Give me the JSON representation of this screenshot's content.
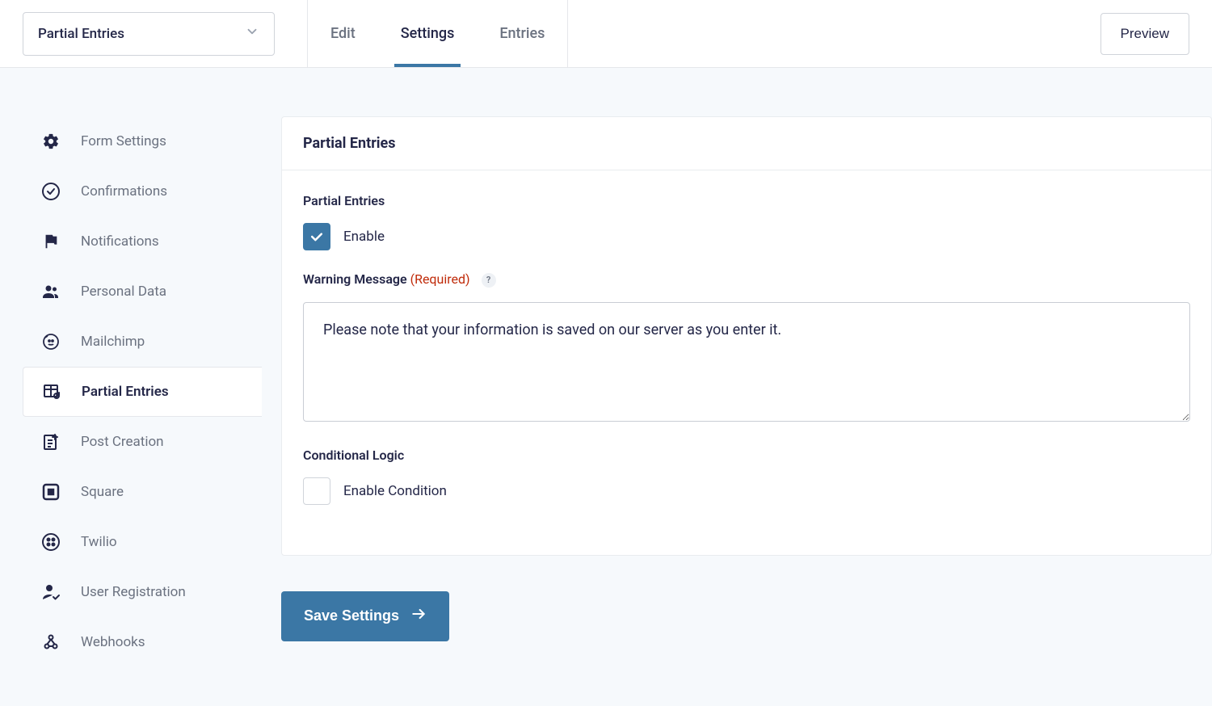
{
  "header": {
    "form_select": "Partial Entries",
    "tabs": {
      "edit": "Edit",
      "settings": "Settings",
      "entries": "Entries"
    },
    "preview_button": "Preview"
  },
  "sidebar": {
    "items": [
      {
        "label": "Form Settings",
        "icon": "gear-icon",
        "active": false
      },
      {
        "label": "Confirmations",
        "icon": "check-circle-icon",
        "active": false
      },
      {
        "label": "Notifications",
        "icon": "flag-icon",
        "active": false
      },
      {
        "label": "Personal Data",
        "icon": "people-icon",
        "active": false
      },
      {
        "label": "Mailchimp",
        "icon": "mailchimp-icon",
        "active": false
      },
      {
        "label": "Partial Entries",
        "icon": "table-refresh-icon",
        "active": true
      },
      {
        "label": "Post Creation",
        "icon": "document-plus-icon",
        "active": false
      },
      {
        "label": "Square",
        "icon": "square-icon",
        "active": false
      },
      {
        "label": "Twilio",
        "icon": "dots-circle-icon",
        "active": false
      },
      {
        "label": "User Registration",
        "icon": "user-check-icon",
        "active": false
      },
      {
        "label": "Webhooks",
        "icon": "webhook-icon",
        "active": false
      }
    ]
  },
  "panel": {
    "title": "Partial Entries",
    "section_label": "Partial Entries",
    "enable_label": "Enable",
    "enable_checked": true,
    "warning_label": "Warning Message",
    "warning_required": "(Required)",
    "help_symbol": "?",
    "warning_value": "Please note that your information is saved on our server as you enter it.",
    "conditional_label": "Conditional Logic",
    "condition_checkbox_label": "Enable Condition",
    "condition_checked": false,
    "save_button": "Save Settings"
  }
}
